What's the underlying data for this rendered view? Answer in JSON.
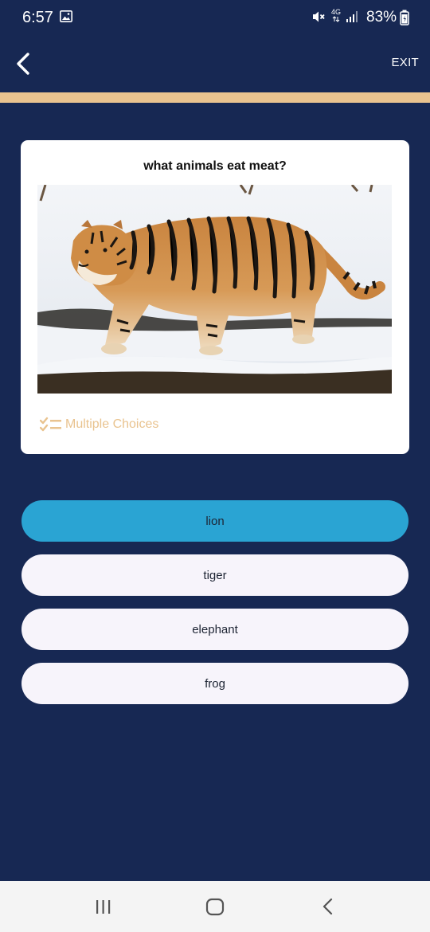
{
  "status_bar": {
    "time": "6:57",
    "network": "4G",
    "battery": "83%",
    "icons": [
      "gallery-icon",
      "mute-icon",
      "signal-icon",
      "battery-charging-icon"
    ]
  },
  "app_bar": {
    "back_icon": "chevron-left-icon",
    "exit_label": "EXIT",
    "accent_color": "#e9c38f"
  },
  "question": {
    "text": "what animals eat meat?",
    "image_subject": "tiger",
    "type_icon": "checklist-icon",
    "type_label": "Multiple Choices"
  },
  "answers": [
    {
      "label": "lion",
      "selected": true
    },
    {
      "label": "tiger",
      "selected": false
    },
    {
      "label": "elephant",
      "selected": false
    },
    {
      "label": "frog",
      "selected": false
    }
  ],
  "nav_bar": {
    "icons": [
      "recent-apps-icon",
      "home-icon",
      "back-icon"
    ]
  },
  "colors": {
    "background": "#172853",
    "accent": "#e9c38f",
    "selected_answer": "#2aa4d3",
    "answer_bg": "#f7f4fb"
  }
}
